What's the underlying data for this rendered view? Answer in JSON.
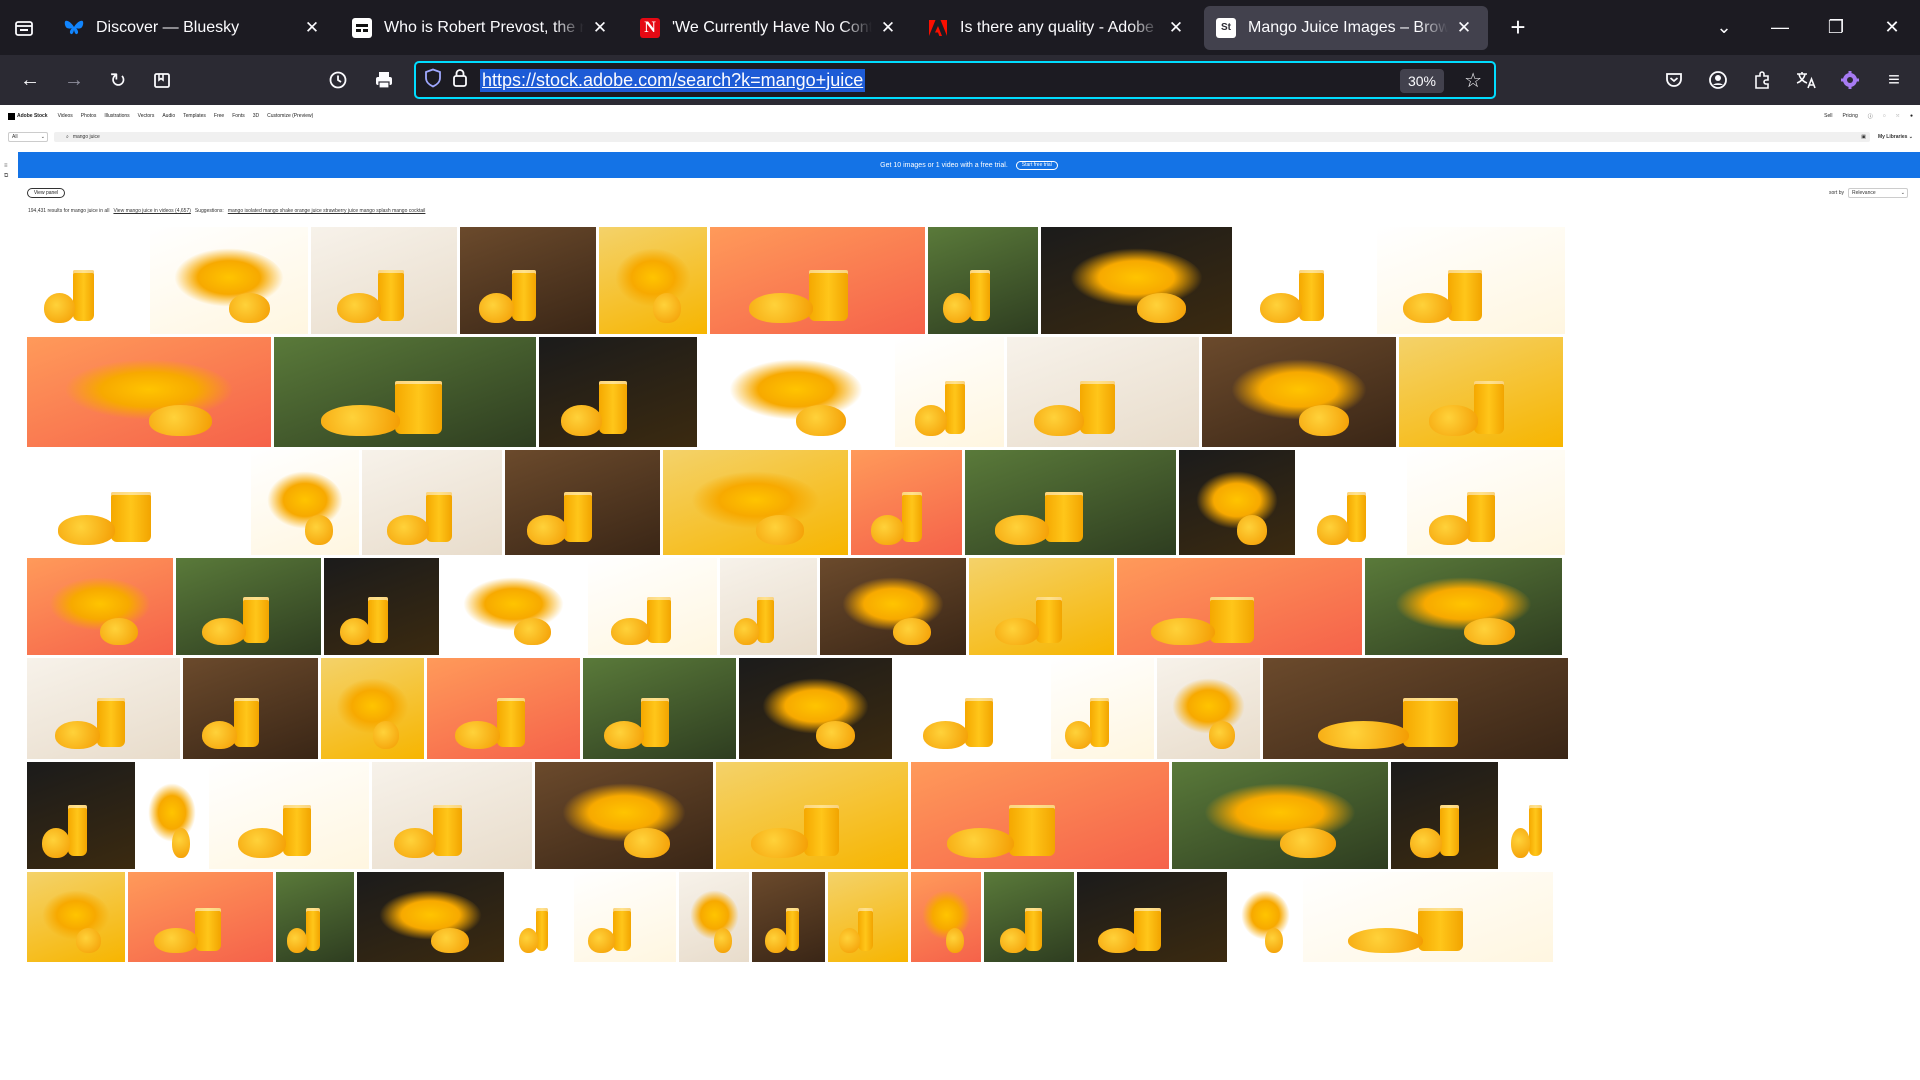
{
  "tabs": [
    {
      "title": "Discover — Bluesky",
      "icon": "bluesky-icon",
      "color": "#1185fe"
    },
    {
      "title": "Who is Robert Prevost, the new",
      "icon": "news-icon",
      "color": "#ffffff"
    },
    {
      "title": "'We Currently Have No Contain",
      "icon": "n-logo-icon",
      "color": "#e50914"
    },
    {
      "title": "Is there any quality - Adobe Cor",
      "icon": "adobe-icon",
      "color": "#fa0f00"
    },
    {
      "title": "Mango Juice Images – Browse",
      "icon": "adobe-stock-icon",
      "color": "#2b2a33",
      "active": true
    }
  ],
  "url": "https://stock.adobe.com/search?k=mango+juice",
  "zoom": "30%",
  "adobe": {
    "logo": "Adobe Stock",
    "nav": [
      "Videos",
      "Photos",
      "Illustrations",
      "Vectors",
      "Audio",
      "Templates",
      "Free",
      "Fonts",
      "3D",
      "Customize (Preview)"
    ],
    "right": [
      "Sell",
      "Pricing"
    ],
    "filter": "All",
    "query": "mango juice",
    "libraries": "My Libraries",
    "promo_text": "Get 10 images or 1 video with a free trial.",
    "promo_button": "Start free trial",
    "view_panel": "View panel",
    "sort_label": "sort by",
    "sort_value": "Relevance",
    "results_text": "194,431 results for mango juice in all",
    "view_videos": "View mango juice in videos (4,657)",
    "suggestions_label": "Suggestions:",
    "suggestions": "mango isolated  mango shake  orange juice  strawberry juice  mango splash  mango cocktail"
  },
  "colors": {
    "accent": "#00ddff",
    "promo": "#1473e6",
    "chrome": "#1c1b22"
  }
}
